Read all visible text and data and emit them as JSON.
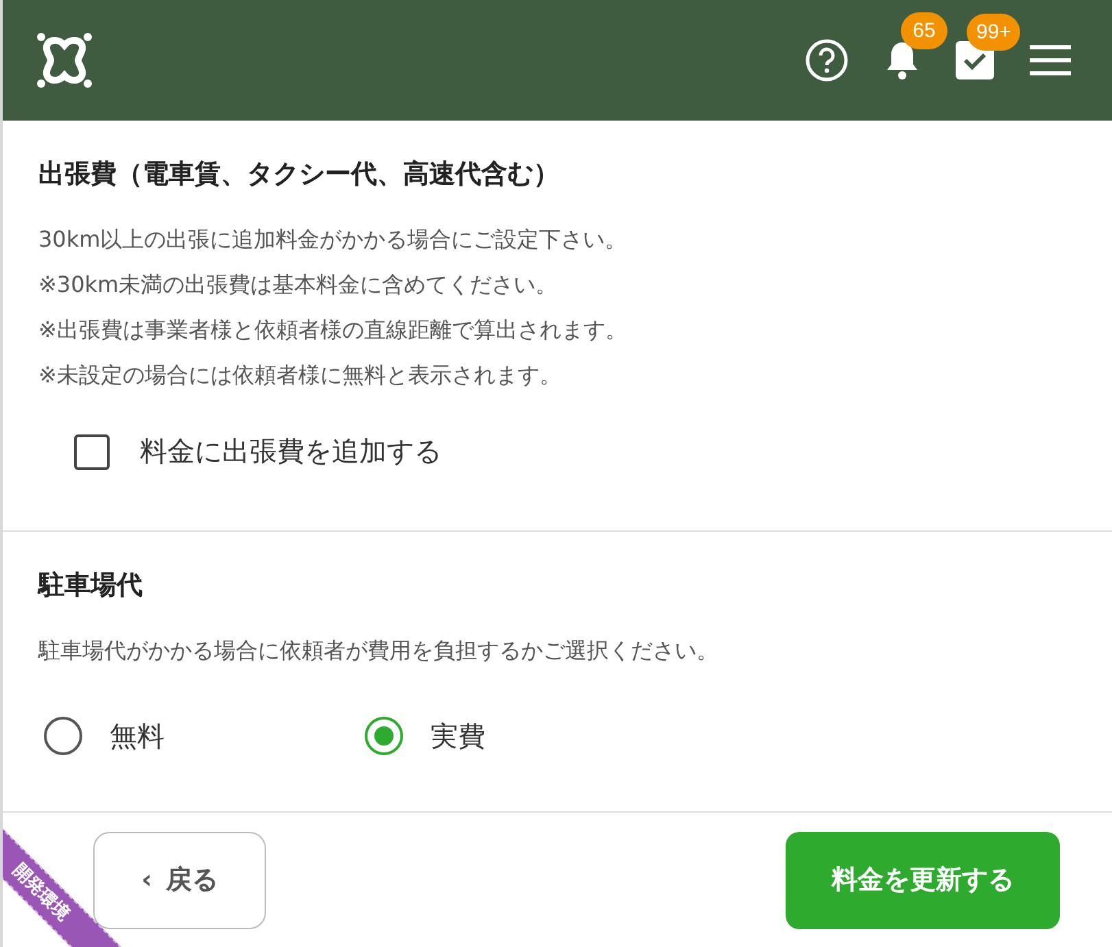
{
  "header": {
    "notifications": {
      "count": "65"
    },
    "tasks": {
      "count": "99+"
    }
  },
  "travel": {
    "title": "出張費（電車賃、タクシー代、高速代含む）",
    "lines": [
      "30km以上の出張に追加料金がかかる場合にご設定下さい。",
      "※30km未満の出張費は基本料金に含めてください。",
      "※出張費は事業者様と依頼者様の直線距離で算出されます。",
      "※未設定の場合には依頼者様に無料と表示されます。"
    ],
    "checkbox": {
      "label": "料金に出張費を追加する",
      "checked": false
    }
  },
  "parking": {
    "title": "駐車場代",
    "description": "駐車場代がかかる場合に依頼者が費用を負担するかご選択ください。",
    "options": [
      {
        "label": "無料",
        "selected": false
      },
      {
        "label": "実費",
        "selected": true
      }
    ]
  },
  "footer": {
    "back": {
      "icon": "‹",
      "label": "戻る"
    },
    "submit": "料金を更新する"
  },
  "ribbon": "開発環境"
}
